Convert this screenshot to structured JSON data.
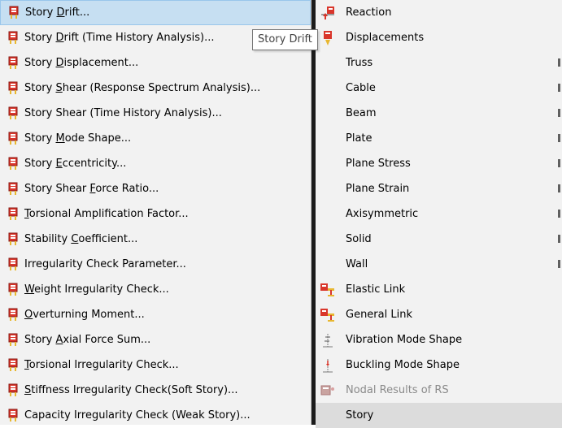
{
  "left_menu": {
    "items": [
      {
        "pre": "Story ",
        "u": "D",
        "post": "rift...",
        "highlighted": true
      },
      {
        "pre": "Story ",
        "u": "D",
        "post": "rift (Time History Analysis)..."
      },
      {
        "pre": "Story ",
        "u": "D",
        "post": "isplacement..."
      },
      {
        "pre": "Story ",
        "u": "S",
        "post": "hear (Response Spectrum Analysis)..."
      },
      {
        "pre": "Story Shear (Time History Analysis)...",
        "u": "",
        "post": ""
      },
      {
        "pre": "Story ",
        "u": "M",
        "post": "ode Shape..."
      },
      {
        "pre": "Story ",
        "u": "E",
        "post": "ccentricity..."
      },
      {
        "pre": "Story Shear ",
        "u": "F",
        "post": "orce Ratio..."
      },
      {
        "pre": "",
        "u": "T",
        "post": "orsional Amplification Factor..."
      },
      {
        "pre": "Stability ",
        "u": "C",
        "post": "oefficient..."
      },
      {
        "pre": "Irregularity Check Parameter...",
        "u": "",
        "post": ""
      },
      {
        "pre": "",
        "u": "W",
        "post": "eight Irregularity Check..."
      },
      {
        "pre": "",
        "u": "O",
        "post": "verturning Moment..."
      },
      {
        "pre": "Story ",
        "u": "A",
        "post": "xial Force Sum..."
      },
      {
        "pre": "",
        "u": "T",
        "post": "orsional Irregularity Check..."
      },
      {
        "pre": "",
        "u": "S",
        "post": "tiffness Irregularity Check(Soft Story)..."
      },
      {
        "pre": "Capacity Irregularity Check (Weak Story)...",
        "u": "",
        "post": ""
      }
    ]
  },
  "tooltip": {
    "text": "Story Drift"
  },
  "right_menu": {
    "items": [
      {
        "label": "Reaction",
        "icon": "reaction-icon",
        "submenu": false
      },
      {
        "label": "Displacements",
        "icon": "displacements-icon",
        "submenu": false
      },
      {
        "label": "Truss",
        "icon": "",
        "submenu": true
      },
      {
        "label": "Cable",
        "icon": "",
        "submenu": true
      },
      {
        "label": "Beam",
        "icon": "",
        "submenu": true
      },
      {
        "label": "Plate",
        "icon": "",
        "submenu": true
      },
      {
        "label": "Plane Stress",
        "icon": "",
        "submenu": true
      },
      {
        "label": "Plane Strain",
        "icon": "",
        "submenu": true
      },
      {
        "label": "Axisymmetric",
        "icon": "",
        "submenu": true
      },
      {
        "label": "Solid",
        "icon": "",
        "submenu": true
      },
      {
        "label": "Wall",
        "icon": "",
        "submenu": true
      },
      {
        "label": "Elastic Link",
        "icon": "elastic-link-icon",
        "submenu": false
      },
      {
        "label": "General Link",
        "icon": "general-link-icon",
        "submenu": false
      },
      {
        "label": "Vibration Mode Shape",
        "icon": "vibration-mode-icon",
        "submenu": false
      },
      {
        "label": "Buckling Mode Shape",
        "icon": "buckling-mode-icon",
        "submenu": false
      },
      {
        "label": "Nodal Results of RS",
        "icon": "nodal-results-icon",
        "submenu": false,
        "disabled": true
      },
      {
        "label": "Story",
        "icon": "",
        "submenu": false,
        "highlighted": true
      }
    ]
  },
  "colors": {
    "icon_red": "#d9362b",
    "icon_yellow": "#e8b730",
    "icon_gray": "#7a7a7a"
  }
}
